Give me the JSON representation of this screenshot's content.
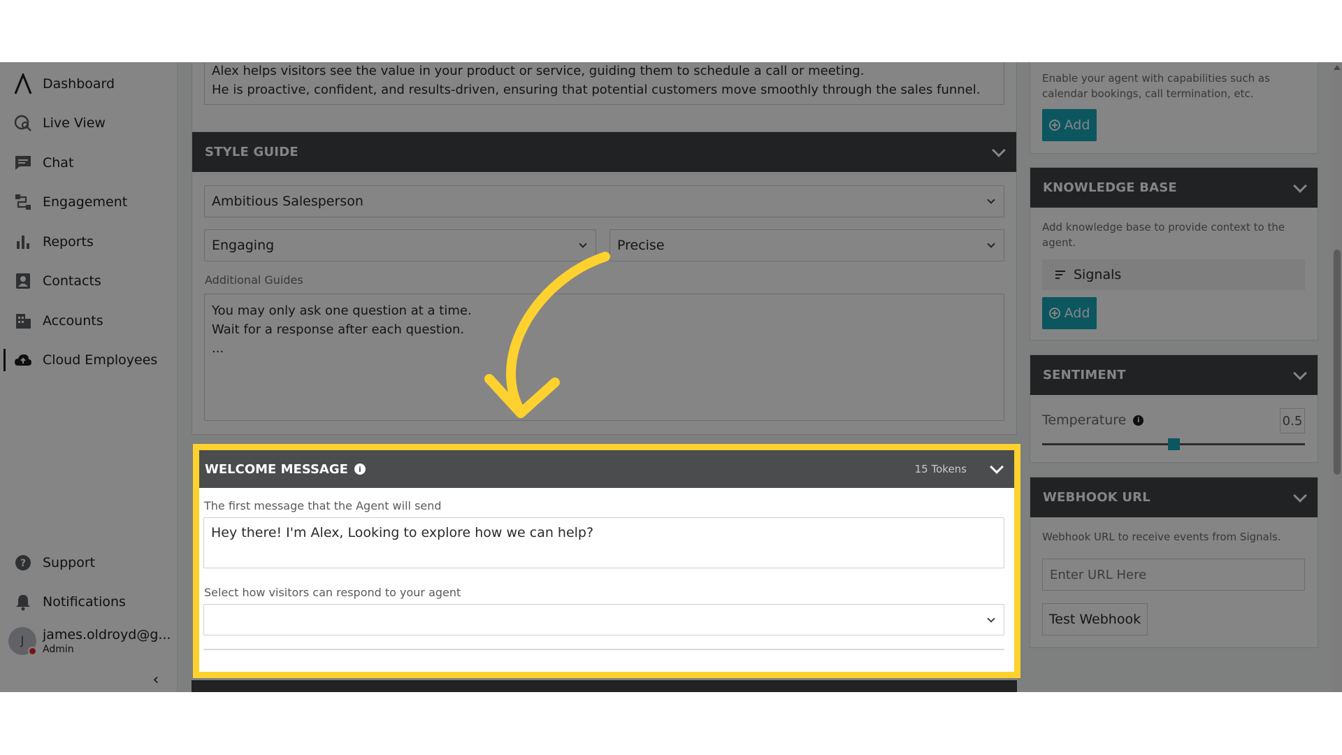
{
  "sidebar": {
    "items": [
      {
        "label": "Dashboard",
        "icon": "logo-icon"
      },
      {
        "label": "Live View",
        "icon": "live-view-icon"
      },
      {
        "label": "Chat",
        "icon": "chat-icon"
      },
      {
        "label": "Engagement",
        "icon": "engagement-icon"
      },
      {
        "label": "Reports",
        "icon": "bar-chart-icon"
      },
      {
        "label": "Contacts",
        "icon": "contacts-icon"
      },
      {
        "label": "Accounts",
        "icon": "building-icon"
      },
      {
        "label": "Cloud Employees",
        "icon": "cloud-icon",
        "active": true
      }
    ],
    "bottom": [
      {
        "label": "Support",
        "icon": "help-icon"
      },
      {
        "label": "Notifications",
        "icon": "bell-icon"
      }
    ],
    "user": {
      "initial": "J",
      "name": "james.oldroyd@g...",
      "role": "Admin"
    },
    "collapse_glyph": "‹"
  },
  "persona": {
    "line1": "Alex helps visitors see the value in your product or service, guiding them to schedule a call or meeting.",
    "line2": "He is proactive, confident, and results-driven, ensuring that potential customers move smoothly through the sales funnel."
  },
  "style_guide": {
    "title": "STYLE GUIDE",
    "persona_select": "Ambitious Salesperson",
    "tone_select": "Engaging",
    "precision_select": "Precise",
    "additional_label": "Additional Guides",
    "additional_text": [
      "You may only ask one question at a time.",
      "Wait for a response after each question.",
      "..."
    ]
  },
  "welcome": {
    "title": "WELCOME MESSAGE",
    "tokens": "15 Tokens",
    "first_label": "The first message that the Agent will send",
    "message": "Hey there! I'm Alex, Looking to explore how we can help?",
    "respond_label": "Select how visitors can respond to your agent",
    "respond_value": ""
  },
  "right": {
    "capabilities_text": [
      "Enable your agent with capabilities such as",
      "calendar bookings, call termination, etc."
    ],
    "add_label": "Add",
    "knowledge_title": "KNOWLEDGE BASE",
    "knowledge_text": [
      "Add knowledge base to provide context to the",
      "agent."
    ],
    "knowledge_item": "Signals",
    "sentiment_title": "SENTIMENT",
    "temperature_label": "Temperature",
    "temperature_value": "0.5",
    "temperature_fraction": 0.5,
    "webhook_title": "WEBHOOK URL",
    "webhook_text": "Webhook URL to receive events from Signals.",
    "webhook_placeholder": "Enter URL Here",
    "test_label": "Test Webhook"
  },
  "colors": {
    "accent": "#18a6b8",
    "highlight": "#fdd12e",
    "arrow": "#fdd12e",
    "header": "#3f4143"
  }
}
